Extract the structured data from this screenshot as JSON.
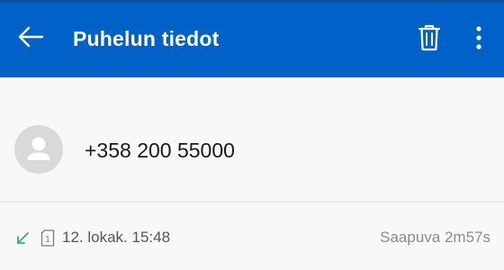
{
  "appbar": {
    "title": "Puhelun tiedot",
    "back_icon": "arrow-left-icon",
    "delete_icon": "trash-icon",
    "more_icon": "more-vertical-icon",
    "background_color": "#0062C8"
  },
  "contact": {
    "avatar_icon": "person-icon",
    "phone_number": "+358 200 55000"
  },
  "call": {
    "direction_icon": "incoming-call-icon",
    "direction_color": "#2fb36e",
    "sim_icon": "sim-1-icon",
    "sim_number": "1",
    "datetime": "12. lokak. 15:48",
    "summary": "Saapuva 2m57s"
  }
}
